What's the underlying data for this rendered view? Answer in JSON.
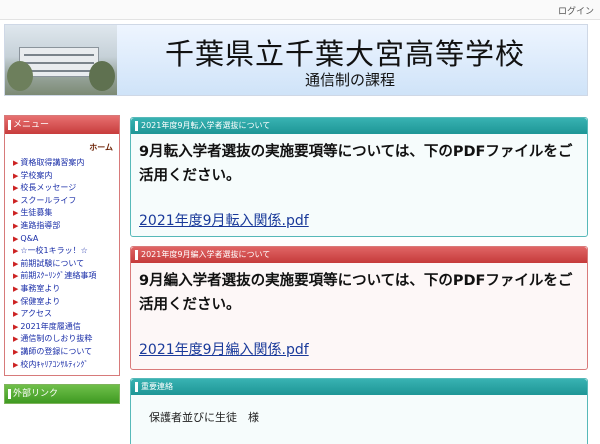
{
  "topbar": {
    "login": "ログイン"
  },
  "header": {
    "title": "千葉県立千葉大宮高等学校",
    "subtitle": "通信制の課程"
  },
  "sidebar": {
    "menu_title": "メニュー",
    "home": "ホーム",
    "items": [
      "資格取得講習案内",
      "学校案内",
      "校長メッセージ",
      "スクールライフ",
      "生徒募集",
      "進路指導部",
      "Q&A",
      "☆一校1キラッ！☆",
      "前期試験について",
      "前期ｽｸｰﾘﾝｸﾞ連絡事項",
      "事務室より",
      "保健室より",
      "アクセス",
      "2021年度履通信",
      "通信制のしおり抜粋",
      "講師の登録について",
      "校内ｷｬﾘｱｺﾝｻﾙﾃｨﾝｸﾞ"
    ],
    "external_title": "外部リンク"
  },
  "panels": {
    "transfer": {
      "title": "2021年度9月転入学者選抜について",
      "text": "9月転入学者選抜の実施要項等については、下のPDFファイルをご活用ください。",
      "link": "2021年度9月転入関係.pdf"
    },
    "reentry": {
      "title": "2021年度9月編入学者選抜について",
      "text": "9月編入学者選抜の実施要項等については、下のPDFファイルをご活用ください。",
      "link": "2021年度9月編入関係.pdf"
    },
    "notice": {
      "title": "重要連絡",
      "text": "保護者並びに生徒　様"
    }
  }
}
